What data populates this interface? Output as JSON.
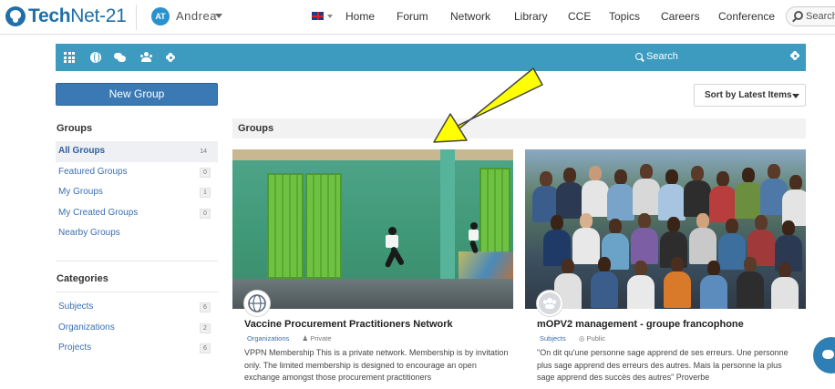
{
  "header": {
    "logo_bold": "Tech",
    "logo_thin": "Net-21",
    "avatar_initials": "AT",
    "username": "Andrea",
    "nav": [
      "Home",
      "Forum",
      "Network",
      "Library",
      "CCE",
      "Topics",
      "Careers",
      "Conference"
    ],
    "search_placeholder": "Search"
  },
  "toolbar": {
    "icons": [
      "grid-icon",
      "globe-icon",
      "chat-icon",
      "users-icon",
      "gear-icon"
    ],
    "search_label": "Search",
    "accent": "#3d9bbf"
  },
  "sidebar": {
    "new_group_label": "New Group",
    "groups_heading": "Groups",
    "groups": [
      {
        "label": "All Groups",
        "count": "14"
      },
      {
        "label": "Featured Groups",
        "count": "0"
      },
      {
        "label": "My Groups",
        "count": "1"
      },
      {
        "label": "My Created Groups",
        "count": "0"
      },
      {
        "label": "Nearby Groups",
        "count": ""
      }
    ],
    "categories_heading": "Categories",
    "categories": [
      {
        "label": "Subjects",
        "count": "6"
      },
      {
        "label": "Organizations",
        "count": "2"
      },
      {
        "label": "Projects",
        "count": "6"
      }
    ]
  },
  "main": {
    "sort_label": "Sort by Latest Items",
    "section_title": "Groups",
    "cards": [
      {
        "title": "Vaccine Procurement Practitioners Network",
        "category": "Organizations",
        "privacy": "Private",
        "description": "VPPN Membership This is a private network. Membership is by invitation only. The limited membership is designed to encourage an open exchange amongst those procurement practitioners"
      },
      {
        "title": "mOPV2 management - groupe francophone",
        "category": "Subjects",
        "privacy": "Public",
        "description": "\"On dit qu'une personne sage apprend de ses erreurs. Une personne plus sage apprend des erreurs des autres. Mais la personne la plus sage apprend des succès des autres\" Proverbe"
      }
    ]
  },
  "colors": {
    "brand": "#1f6fa8",
    "new_group_button": "#3a79b4",
    "link": "#3a6fb0",
    "annotation_arrow": "#ffff00"
  }
}
